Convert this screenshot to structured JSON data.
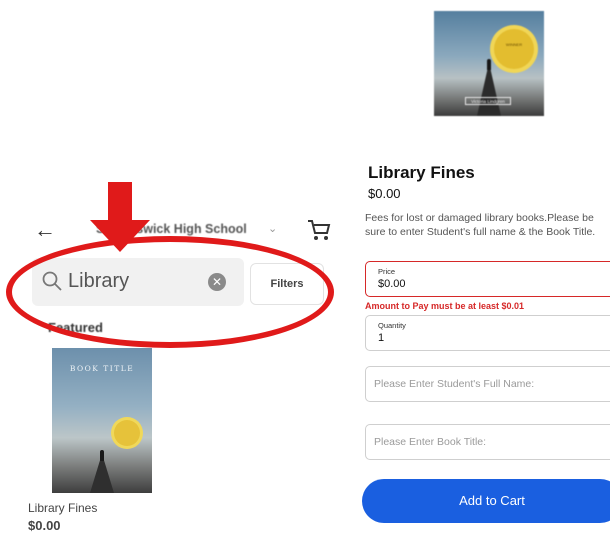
{
  "header": {
    "school_name": "S... ...nswick High School"
  },
  "search": {
    "value": "Library",
    "filters_label": "Filters"
  },
  "featured": {
    "label": "Featured"
  },
  "product_card": {
    "cover_title": "BOOK TITLE",
    "title": "Library Fines",
    "price": "$0.00"
  },
  "detail": {
    "cover_seal_text": "WINNER",
    "cover_author": "Victoria Lindgren",
    "title": "Library Fines",
    "price": "$0.00",
    "description": "Fees for lost or damaged library books.Please be sure to enter Student's full name & the Book Title.",
    "price_field": {
      "label": "Price",
      "value": "$0.00"
    },
    "price_error": "Amount to Pay must be at least $0.01",
    "quantity_field": {
      "label": "Quantity",
      "value": "1"
    },
    "student_name_placeholder": "Please Enter Student's Full Name:",
    "book_title_placeholder": "Please Enter Book Title:",
    "add_to_cart_label": "Add to Cart"
  },
  "colors": {
    "primary_button": "#1a5fe0",
    "error": "#d62828",
    "annotation_red": "#e01a1a"
  },
  "icons": [
    "back-arrow-icon",
    "chevron-down-icon",
    "cart-icon",
    "search-icon",
    "clear-icon"
  ]
}
